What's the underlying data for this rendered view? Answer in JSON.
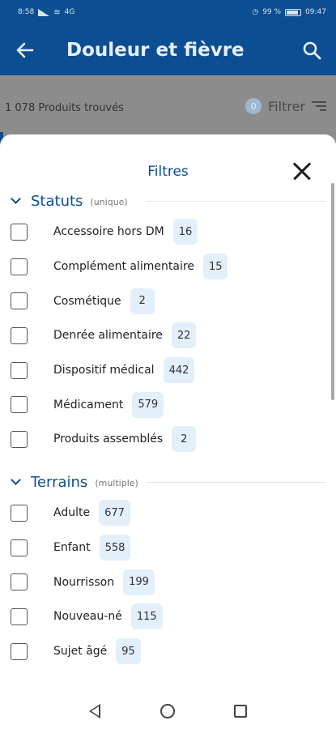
{
  "status_bar": {
    "time_left": "8:58",
    "network": "4G",
    "battery": "99 %",
    "time_right": "09:47"
  },
  "header": {
    "title": "Douleur et fièvre",
    "back_icon": "arrow-left-icon",
    "search_icon": "search-icon"
  },
  "results": {
    "count_text": "1 078 Produits trouvés",
    "filter_badge": "0",
    "filter_label": "Filtrer"
  },
  "sheet": {
    "title": "Filtres",
    "sections": [
      {
        "title": "Statuts",
        "note": "(unique)",
        "options": [
          {
            "label": "Accessoire hors DM",
            "count": "16",
            "checked": false
          },
          {
            "label": "Complément alimentaire",
            "count": "15",
            "checked": false
          },
          {
            "label": "Cosmétique",
            "count": "2",
            "checked": false
          },
          {
            "label": "Denrée alimentaire",
            "count": "22",
            "checked": false
          },
          {
            "label": "Dispositif médical",
            "count": "442",
            "checked": false
          },
          {
            "label": "Médicament",
            "count": "579",
            "checked": false
          },
          {
            "label": "Produits assemblés",
            "count": "2",
            "checked": false
          }
        ]
      },
      {
        "title": "Terrains",
        "note": "(multiple)",
        "options": [
          {
            "label": "Adulte",
            "count": "677",
            "checked": false
          },
          {
            "label": "Enfant",
            "count": "558",
            "checked": false
          },
          {
            "label": "Nourrisson",
            "count": "199",
            "checked": false
          },
          {
            "label": "Nouveau-né",
            "count": "115",
            "checked": false
          },
          {
            "label": "Sujet âgé",
            "count": "95",
            "checked": false
          }
        ]
      }
    ]
  },
  "colors": {
    "primary": "#0c4e92",
    "pill": "#e3effa"
  }
}
